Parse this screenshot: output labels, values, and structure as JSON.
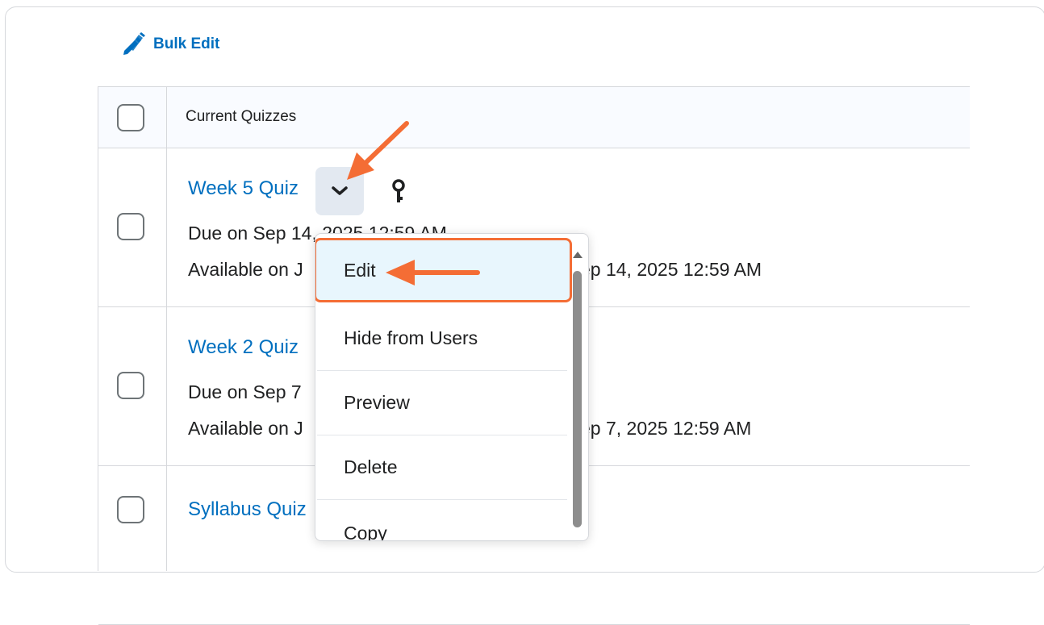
{
  "toolbar": {
    "bulk_edit_label": "Bulk Edit"
  },
  "table": {
    "header": "Current Quizzes",
    "rows": [
      {
        "title": "Week 5 Quiz",
        "due": "Due on Sep 14, 2025 12:59 AM",
        "available_prefix": "Available on J",
        "available_suffix": "ep 14, 2025 12:59 AM"
      },
      {
        "title": "Week 2 Quiz",
        "due": "Due on Sep 7",
        "available_prefix": "Available on J",
        "available_suffix": "ep 7, 2025 12:59 AM"
      },
      {
        "title": "Syllabus Quiz"
      }
    ]
  },
  "context_menu": {
    "items": [
      "Edit",
      "Hide from Users",
      "Preview",
      "Delete",
      "Copy"
    ],
    "active": "Edit"
  },
  "icons": {
    "bulk_edit": "pencils-icon",
    "chevron": "chevron-down-icon",
    "key": "key-icon"
  },
  "colors": {
    "link": "#006fbf",
    "highlight": "#f46d35",
    "active_bg": "#e8f6fd"
  }
}
